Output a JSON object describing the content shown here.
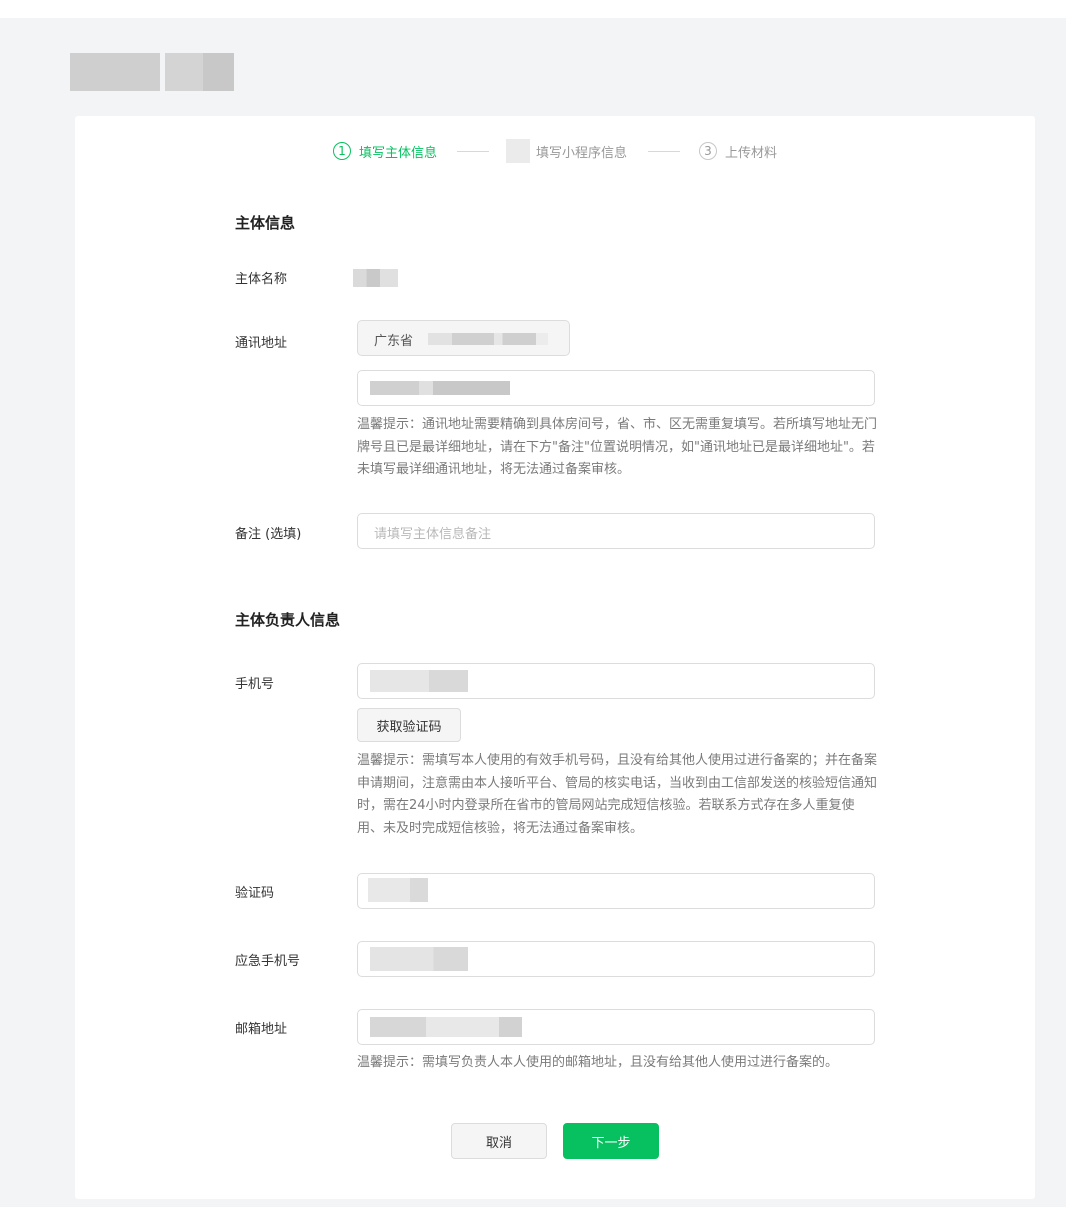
{
  "steps": [
    {
      "number": "1",
      "label": "填写主体信息",
      "state": "active"
    },
    {
      "number": "",
      "label": "填写小程序信息",
      "state": "inactive"
    },
    {
      "number": "3",
      "label": "上传材料",
      "state": "inactive"
    }
  ],
  "subject_info": {
    "title": "主体信息",
    "name_label": "主体名称",
    "address_label": "通讯地址",
    "province_value": "广东省",
    "address_hint": "温馨提示：通讯地址需要精确到具体房间号，省、市、区无需重复填写。若所填写地址无门牌号且已是最详细地址，请在下方\"备注\"位置说明情况，如\"通讯地址已是最详细地址\"。若未填写最详细通讯地址，将无法通过备案审核。",
    "remark_label": "备注 (选填)",
    "remark_placeholder": "请填写主体信息备注"
  },
  "person_info": {
    "title": "主体负责人信息",
    "phone_label": "手机号",
    "get_code_button": "获取验证码",
    "phone_hint": "温馨提示：需填写本人使用的有效手机号码，且没有给其他人使用过进行备案的；并在备案申请期间，注意需由本人接听平台、管局的核实电话，当收到由工信部发送的核验短信通知时，需在24小时内登录所在省市的管局网站完成短信核验。若联系方式存在多人重复使用、未及时完成短信核验，将无法通过备案审核。",
    "code_label": "验证码",
    "emergency_phone_label": "应急手机号",
    "email_label": "邮箱地址",
    "email_hint": "温馨提示：需填写负责人本人使用的邮箱地址，且没有给其他人使用过进行备案的。"
  },
  "actions": {
    "cancel_label": "取消",
    "next_label": "下一步"
  },
  "colors": {
    "accent": "#07c160",
    "page_bg": "#f3f4f5"
  }
}
